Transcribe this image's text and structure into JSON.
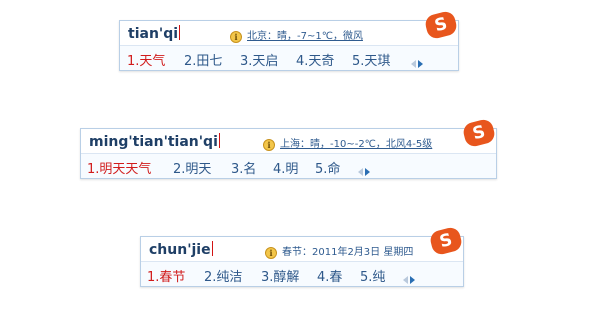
{
  "bars": [
    {
      "pinyin": "tian'qi",
      "info": {
        "text": "北京：晴，-7~1℃，微风",
        "underlined": true
      },
      "candidates": [
        "1.天气",
        "2.田七",
        "3.天启",
        "4.天奇",
        "5.天琪"
      ]
    },
    {
      "pinyin": "ming'tian'tian'qi",
      "info": {
        "text": "上海：晴，-10~-2℃，北风4-5级",
        "underlined": true
      },
      "candidates": [
        "1.明天天气",
        "2.明天",
        "3.名",
        "4.明",
        "5.命"
      ]
    },
    {
      "pinyin": "chun'jie",
      "info": {
        "text": "春节：2011年2月3日 星期四",
        "underlined": false
      },
      "candidates": [
        "1.春节",
        "2.纯洁",
        "3.醇解",
        "4.春",
        "5.纯"
      ]
    }
  ],
  "icons": {
    "info": "i",
    "logo": "S",
    "prev": "prev-page-icon",
    "next": "next-page-icon"
  },
  "colors": {
    "pinyin": "#1f3f66",
    "info": "#2f5b8f",
    "candidate": "#2e588a",
    "first_candidate": "#d11c1c",
    "logo": "#e8561d",
    "border": "#b9cfe6"
  }
}
